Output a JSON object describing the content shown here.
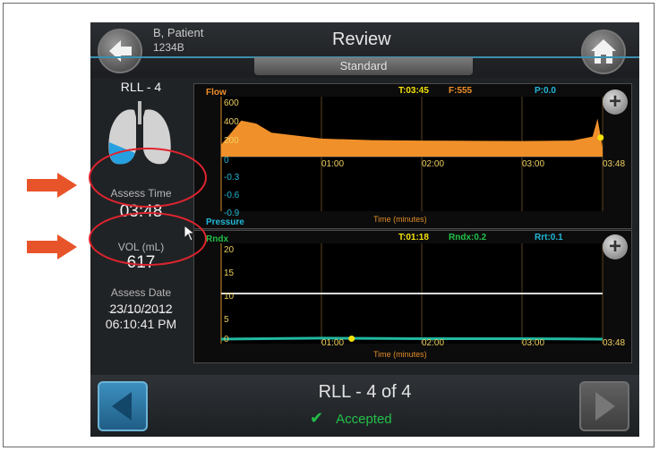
{
  "header": {
    "patient_name": "B, Patient",
    "patient_id": "1234B",
    "title": "Review",
    "mode_tab": "Standard"
  },
  "left_panel": {
    "lobe": "RLL - 4",
    "assess_time_label": "Assess Time",
    "assess_time_value": "03:48",
    "vol_label": "VOL (mL)",
    "vol_value": "617",
    "assess_date_label": "Assess Date",
    "assess_date": "23/10/2012",
    "assess_clock": "06:10:41 PM"
  },
  "flow_chart": {
    "label": "Flow",
    "pressure_label": "Pressure",
    "header": {
      "t": "T:03:45",
      "f": "F:555",
      "p": "P:0.0"
    },
    "xlabel": "Time (minutes)",
    "y_ticks_flow": [
      "600",
      "400",
      "200",
      "0"
    ],
    "y_ticks_pressure": [
      "-0.3",
      "-0.6",
      "-0.9"
    ],
    "x_ticks": [
      "01:00",
      "02:00",
      "03:00",
      "03:48"
    ]
  },
  "rndx_chart": {
    "label": "Rndx",
    "header": {
      "t": "T:01:18",
      "rndx": "Rndx:0.2",
      "rrt": "Rrt:0.1"
    },
    "xlabel": "Time (minutes)",
    "y_ticks": [
      "20",
      "15",
      "10",
      "5",
      "0"
    ],
    "x_ticks": [
      "01:00",
      "02:00",
      "03:00",
      "03:48"
    ]
  },
  "footer": {
    "title": "RLL - 4 of 4",
    "status": "Accepted"
  },
  "chart_data": [
    {
      "type": "area",
      "title": "Flow",
      "xlabel": "Time (minutes)",
      "ylabel": "Flow",
      "x": [
        0.0,
        0.2,
        0.35,
        0.5,
        1.0,
        1.5,
        2.0,
        2.5,
        3.0,
        3.5,
        3.7,
        3.75,
        3.8
      ],
      "values": [
        120,
        360,
        330,
        240,
        180,
        165,
        160,
        158,
        156,
        160,
        200,
        380,
        90
      ],
      "ylim": [
        0,
        600
      ],
      "xlim": [
        0,
        3.8
      ],
      "colors": {
        "flow": "#f0902a",
        "cursor": "#f4e10a"
      }
    },
    {
      "type": "line",
      "title": "Rndx",
      "xlabel": "Time (minutes)",
      "ylim": [
        0,
        20
      ],
      "xlim": [
        0,
        3.8
      ],
      "series": [
        {
          "values": [
            10,
            10,
            10,
            10,
            10
          ],
          "x": [
            0,
            1,
            2,
            3,
            3.8
          ],
          "color": "#dcdcdc"
        },
        {
          "values": [
            0.2,
            0.4,
            0.3,
            0.3,
            0.2
          ],
          "x": [
            0,
            1,
            2,
            3,
            3.8
          ],
          "color": "#22b8a0"
        }
      ],
      "cursor_x": 1.3
    }
  ]
}
